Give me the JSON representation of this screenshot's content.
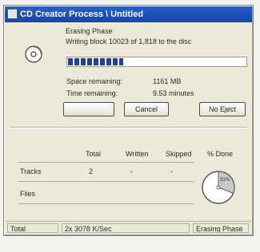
{
  "window": {
    "title": "CD Creator Process \\ Untitled"
  },
  "status": {
    "phase": "Erasing Phase",
    "detail": "Writing block 10023 of 1,818 to the disc",
    "progress_fraction": 0.31,
    "space_remaining_label": "Space remaining:",
    "space_remaining_value": "1161 MB",
    "time_remaining_label": "Time remaining:",
    "time_remaining_value": "9.53 minutes"
  },
  "buttons": {
    "start_label": "",
    "cancel_label": "Cancel",
    "no_eject_label": "No Eject"
  },
  "stats": {
    "headers": [
      "Total",
      "Written",
      "Skipped",
      "% Done"
    ],
    "rows": [
      {
        "label": "Tracks",
        "total": "2",
        "written": "-",
        "skipped": "-"
      },
      {
        "label": "Files",
        "total": "",
        "written": "",
        "skipped": ""
      }
    ],
    "pie_label": "31%"
  },
  "statusbar": {
    "left": "Total",
    "middle": "2x 3078 K/Sec",
    "right": "Erasing Phase"
  },
  "colors": {
    "titlebar": "#1b4fb6",
    "progress_fill": "#1f3fb0"
  }
}
